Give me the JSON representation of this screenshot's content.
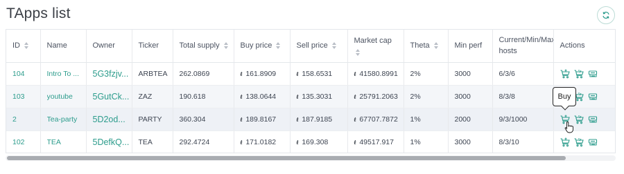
{
  "page": {
    "title": "TApps list"
  },
  "toolbar": {
    "refresh_icon": "refresh-icon"
  },
  "table": {
    "columns": [
      {
        "label": "ID",
        "sortable": true
      },
      {
        "label": "Name",
        "sortable": false
      },
      {
        "label": "Owner",
        "sortable": false
      },
      {
        "label": "Ticker",
        "sortable": false
      },
      {
        "label": "Total supply",
        "sortable": true
      },
      {
        "label": "Buy price",
        "sortable": true
      },
      {
        "label": "Sell price",
        "sortable": true
      },
      {
        "label": "Market cap",
        "sortable": true
      },
      {
        "label": "Theta",
        "sortable": true
      },
      {
        "label": "Min perf",
        "sortable": false
      },
      {
        "label_line1": "Current/Min/Max",
        "label_line2": "hosts",
        "sortable": false
      },
      {
        "label": "Actions",
        "sortable": false
      }
    ],
    "currency_symbol": "ŧ",
    "rows": [
      {
        "id": "104",
        "name": "Intro To ...",
        "owner": "5G3fzjv...",
        "ticker": "ARBTEA",
        "total_supply": "262.0869",
        "buy_price": "161.8909",
        "sell_price": "158.6531",
        "market_cap": "41580.8991",
        "theta": "2%",
        "min_perf": "3000",
        "hosts": "6/3/6"
      },
      {
        "id": "103",
        "name": "youtube",
        "owner": "5GutCk...",
        "ticker": "ZAZ",
        "total_supply": "190.618",
        "buy_price": "138.0644",
        "sell_price": "135.3031",
        "market_cap": "25791.2063",
        "theta": "2%",
        "min_perf": "3000",
        "hosts": "8/3/8"
      },
      {
        "id": "2",
        "name": "Tea-party",
        "owner": "5D2od...",
        "ticker": "PARTY",
        "total_supply": "360.304",
        "buy_price": "189.8167",
        "sell_price": "187.9185",
        "market_cap": "67707.7872",
        "theta": "1%",
        "min_perf": "2000",
        "hosts": "9/3/1000"
      },
      {
        "id": "102",
        "name": "TEA",
        "owner": "5DefkQ...",
        "ticker": "TEA",
        "total_supply": "292.4724",
        "buy_price": "171.0182",
        "sell_price": "169.308",
        "market_cap": "49517.917",
        "theta": "1%",
        "min_perf": "3000",
        "hosts": "8/3/10"
      }
    ],
    "action_icons": [
      "buy-cart-icon",
      "sell-cart-icon",
      "details-icon"
    ]
  },
  "tooltip": {
    "text": "Buy"
  },
  "scrollbar": {
    "thumb_fraction": 0.92
  },
  "colors": {
    "accent": "#2c9c8c",
    "border": "#e4e7eb",
    "row_alt": "#f4f6f9"
  }
}
